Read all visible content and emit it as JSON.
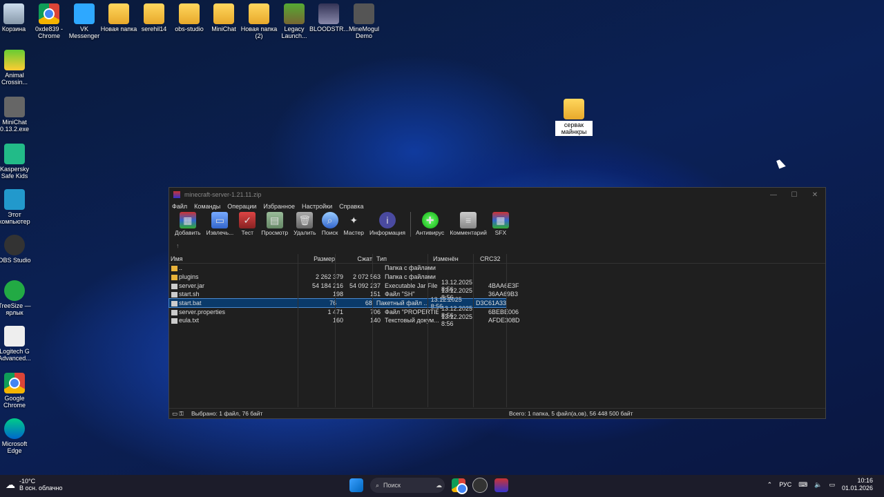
{
  "desktop_top": [
    {
      "label": "Корзина",
      "icon": "recycle-bin-icon"
    },
    {
      "label": "0xde839 - Chrome",
      "icon": "chrome-icon"
    },
    {
      "label": "VK Messenger",
      "icon": "vk-messenger-icon"
    },
    {
      "label": "Новая папка",
      "icon": "folder-icon"
    },
    {
      "label": "serehil14",
      "icon": "folder-icon"
    },
    {
      "label": "obs-studio",
      "icon": "folder-icon"
    },
    {
      "label": "MiniChat",
      "icon": "folder-icon"
    },
    {
      "label": "Новая папка (2)",
      "icon": "folder-icon"
    },
    {
      "label": "Legacy Launch...",
      "icon": "minecraft-icon"
    },
    {
      "label": "BLOODSTR...",
      "icon": "game-icon"
    },
    {
      "label": "MineMogul Demo",
      "icon": "minemogul-icon"
    }
  ],
  "desktop_left": [
    {
      "label": "Animal Crossin...",
      "icon": "animal-crossing-icon"
    },
    {
      "label": "MiniChat 0.13.2.exe",
      "icon": "exe-icon"
    },
    {
      "label": "Kaspersky Safe Kids",
      "icon": "kaspersky-icon"
    },
    {
      "label": "Этот компьютер",
      "icon": "computer-icon"
    },
    {
      "label": "OBS Studio",
      "icon": "obs-icon"
    },
    {
      "label": "TreeSize — ярлык",
      "icon": "treesize-icon"
    },
    {
      "label": "Logitech G Advanced...",
      "icon": "logitech-icon"
    },
    {
      "label": "Google Chrome",
      "icon": "chrome-icon"
    },
    {
      "label": "Microsoft Edge",
      "icon": "edge-icon"
    }
  ],
  "desktop_folder": {
    "label": "сервак майнкры"
  },
  "window": {
    "title": "minecraft-server-1.21.11.zip",
    "menu": [
      "Файл",
      "Команды",
      "Операции",
      "Избранное",
      "Настройки",
      "Справка"
    ],
    "toolbar": [
      {
        "label": "Добавить",
        "icon": "add-archive-icon"
      },
      {
        "label": "Извлечь...",
        "icon": "extract-icon"
      },
      {
        "label": "Тест",
        "icon": "test-icon"
      },
      {
        "label": "Просмотр",
        "icon": "view-icon"
      },
      {
        "label": "Удалить",
        "icon": "delete-icon"
      },
      {
        "label": "Поиск",
        "icon": "search-icon"
      },
      {
        "label": "Мастер",
        "icon": "wizard-icon"
      },
      {
        "label": "Информация",
        "icon": "info-icon"
      },
      {
        "label": "Антивирус",
        "icon": "antivirus-icon"
      },
      {
        "label": "Комментарий",
        "icon": "comment-icon"
      },
      {
        "label": "SFX",
        "icon": "sfx-icon"
      }
    ],
    "columns": [
      "Имя",
      "Размер",
      "Сжат",
      "Тип",
      "Изменён",
      "CRC32"
    ],
    "rows": [
      {
        "name": "..",
        "size": "",
        "packed": "",
        "type": "Папка с файлами",
        "modified": "",
        "crc": "",
        "kind": "folder"
      },
      {
        "name": "plugins",
        "size": "2 262 379",
        "packed": "2 072 563",
        "type": "Папка с файлами",
        "modified": "",
        "crc": "",
        "kind": "folder"
      },
      {
        "name": "server.jar",
        "size": "54 184 216",
        "packed": "54 092 237",
        "type": "Executable Jar File",
        "modified": "13.12.2025 8:56",
        "crc": "4BAA6E3F",
        "kind": "file"
      },
      {
        "name": "start.sh",
        "size": "198",
        "packed": "151",
        "type": "Файл \"SH\"",
        "modified": "13.12.2025 8:56",
        "crc": "36AA69B3",
        "kind": "file"
      },
      {
        "name": "start.bat",
        "size": "76",
        "packed": "68",
        "type": "Пакетный файл ...",
        "modified": "13.12.2025 8:56",
        "crc": "D3C61A33",
        "kind": "file",
        "selected": true
      },
      {
        "name": "server.properties",
        "size": "1 471",
        "packed": "706",
        "type": "Файл \"PROPERTIES\"",
        "modified": "13.12.2025 8:56",
        "crc": "6BEBE006",
        "kind": "file"
      },
      {
        "name": "eula.txt",
        "size": "160",
        "packed": "140",
        "type": "Текстовый докум...",
        "modified": "13.12.2025 8:56",
        "crc": "AFDE308D",
        "kind": "file"
      }
    ],
    "status_left": "Выбрано: 1 файл, 76 байт",
    "status_right": "Всего: 1 папка, 5 файл(а,ов), 56 448 500 байт"
  },
  "taskbar": {
    "temp": "-10°C",
    "weather": "В осн. облачно",
    "search": "Поиск",
    "lang": "РУС",
    "time": "10:16",
    "date": "01.01.2026"
  }
}
